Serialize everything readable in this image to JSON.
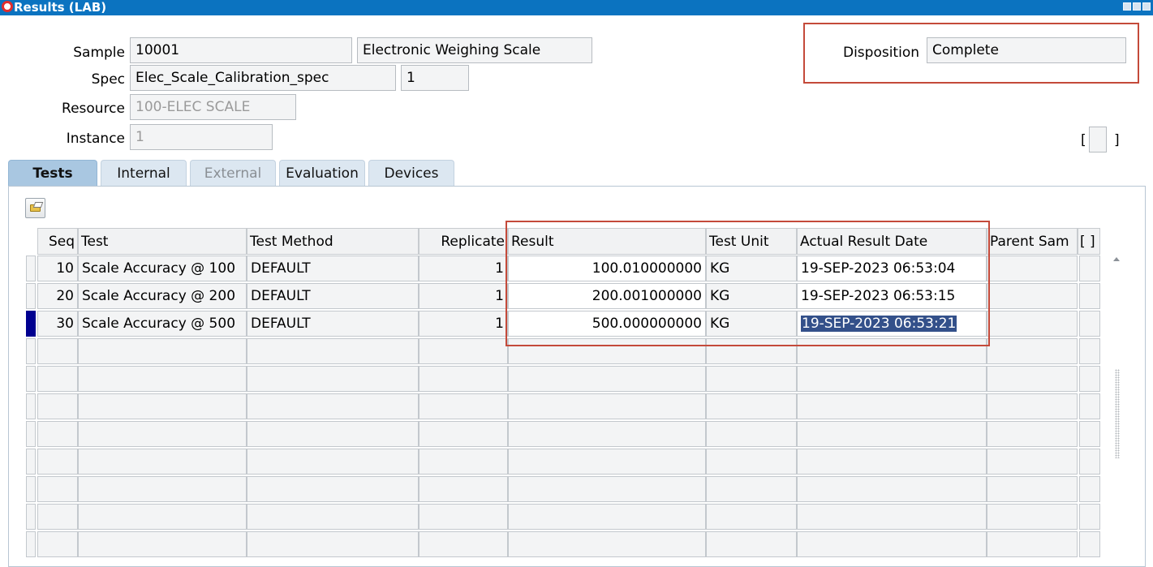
{
  "window": {
    "title": "Results (LAB)"
  },
  "header": {
    "sample_label": "Sample",
    "sample_value": "10001",
    "sample_desc": "Electronic Weighing Scale",
    "spec_label": "Spec",
    "spec_value": "Elec_Scale_Calibration_spec",
    "spec_version": "1",
    "resource_label": "Resource",
    "resource_value": "100-ELEC SCALE",
    "instance_label": "Instance",
    "instance_value": "1",
    "disposition_label": "Disposition",
    "disposition_value": "Complete",
    "bracket_open": "[",
    "bracket_close": "]"
  },
  "tabs": [
    {
      "label": "Tests",
      "state": "active"
    },
    {
      "label": "Internal",
      "state": "normal"
    },
    {
      "label": "External",
      "state": "disabled"
    },
    {
      "label": "Evaluation",
      "state": "normal"
    },
    {
      "label": "Devices",
      "state": "normal"
    }
  ],
  "grid": {
    "columns": {
      "seq": "Seq",
      "test": "Test",
      "test_method": "Test Method",
      "replicate": "Replicate",
      "result": "Result",
      "test_unit": "Test Unit",
      "actual_result_date": "Actual Result Date",
      "parent_sample": "Parent Sam",
      "extra": "[ ]"
    },
    "rows": [
      {
        "seq": "10",
        "test": "Scale Accuracy @ 100",
        "test_method": "DEFAULT",
        "replicate": "1",
        "result": "100.010000000",
        "test_unit": "KG",
        "actual_result_date": "19-SEP-2023 06:53:04"
      },
      {
        "seq": "20",
        "test": "Scale Accuracy @ 200",
        "test_method": "DEFAULT",
        "replicate": "1",
        "result": "200.001000000",
        "test_unit": "KG",
        "actual_result_date": "19-SEP-2023 06:53:15"
      },
      {
        "seq": "30",
        "test": "Scale Accuracy @ 500",
        "test_method": "DEFAULT",
        "replicate": "1",
        "result": "500.000000000",
        "test_unit": "KG",
        "actual_result_date": "19-SEP-2023 06:53:21"
      }
    ],
    "icons": {
      "toolbar": "open-folder-icon",
      "scroll_up": "scroll-up-arrow-icon"
    }
  },
  "colors": {
    "titlebar": "#0b73c0",
    "highlight_box": "#c44a3a",
    "selected_text": "#33508a",
    "current_row_marker": "#000090"
  }
}
